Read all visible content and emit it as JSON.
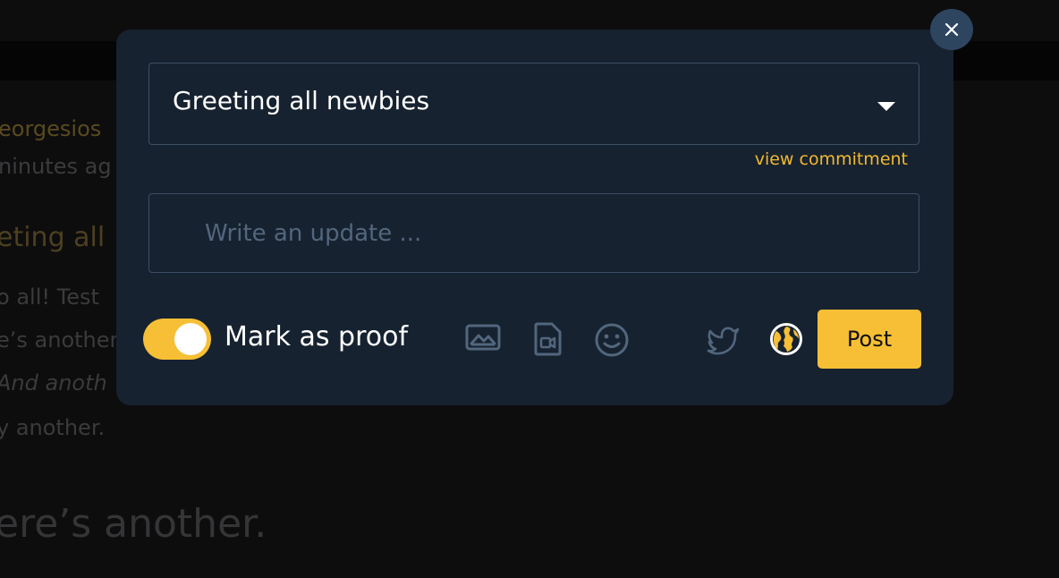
{
  "background": {
    "author": "eorgesios",
    "time": "ninutes ag",
    "post_title": "eting all",
    "lines": [
      "o all! Test",
      "e’s another",
      "And anoth",
      "y another."
    ],
    "heading": "ere’s another."
  },
  "modal": {
    "close_icon": "close-icon",
    "select": {
      "value": "Greeting all newbies",
      "caret_icon": "caret-down-icon"
    },
    "view_commitment_label": "view commitment",
    "update": {
      "placeholder": "Write an update ...",
      "value": ""
    },
    "proof_toggle": {
      "label": "Mark as proof",
      "on": true
    },
    "tools": {
      "image_icon": "image-icon",
      "file_icon": "file-video-icon",
      "emoji_icon": "emoji-icon",
      "twitter_icon": "twitter-icon",
      "globe_icon": "globe-icon"
    },
    "post_label": "Post"
  },
  "colors": {
    "modal_bg": "#172230",
    "accent": "#f6bf35",
    "link": "#f2b92e",
    "border": "#3b4e63",
    "icon_muted": "#52667d",
    "close_bg": "#2e4560"
  }
}
